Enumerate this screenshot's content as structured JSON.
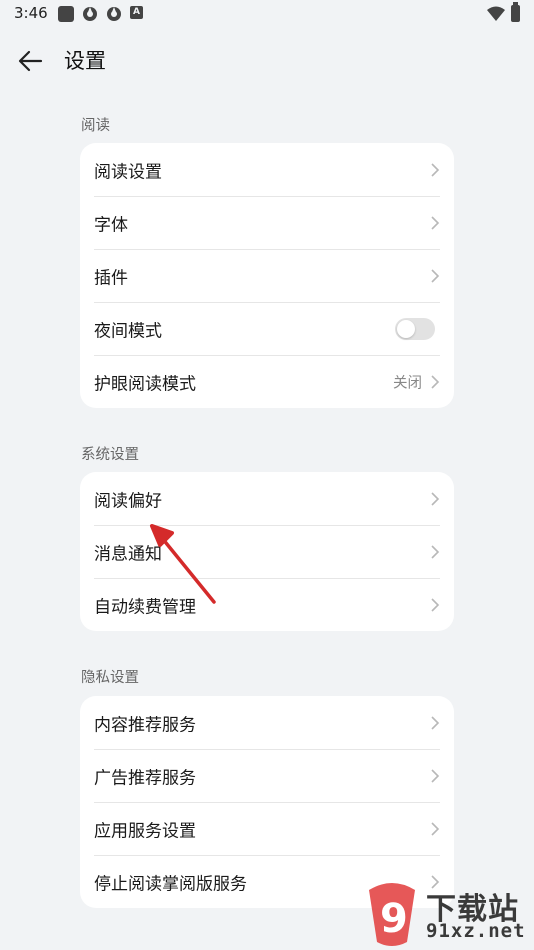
{
  "status_bar": {
    "time": "3:46",
    "a_icon": "A"
  },
  "header": {
    "title": "设置"
  },
  "sections": [
    {
      "label": "阅读",
      "items": [
        {
          "label": "阅读设置",
          "control": "chevron"
        },
        {
          "label": "字体",
          "control": "chevron"
        },
        {
          "label": "插件",
          "control": "chevron"
        },
        {
          "label": "夜间模式",
          "control": "toggle",
          "enabled": false
        },
        {
          "label": "护眼阅读模式",
          "value": "关闭",
          "control": "chevron"
        }
      ]
    },
    {
      "label": "系统设置",
      "items": [
        {
          "label": "阅读偏好",
          "control": "chevron"
        },
        {
          "label": "消息通知",
          "control": "chevron"
        },
        {
          "label": "自动续费管理",
          "control": "chevron"
        }
      ]
    },
    {
      "label": "隐私设置",
      "items": [
        {
          "label": "内容推荐服务",
          "control": "chevron"
        },
        {
          "label": "广告推荐服务",
          "control": "chevron"
        },
        {
          "label": "应用服务设置",
          "control": "chevron"
        },
        {
          "label": "停止阅读掌阅版服务",
          "control": "chevron"
        }
      ]
    }
  ],
  "watermark": {
    "text": "下载站",
    "url": "91xz.net",
    "logo_number": "9"
  },
  "colors": {
    "background": "#f1f3f5",
    "card": "#ffffff",
    "annotation_arrow": "#d42a2a",
    "watermark_red": "#e23b3b"
  }
}
